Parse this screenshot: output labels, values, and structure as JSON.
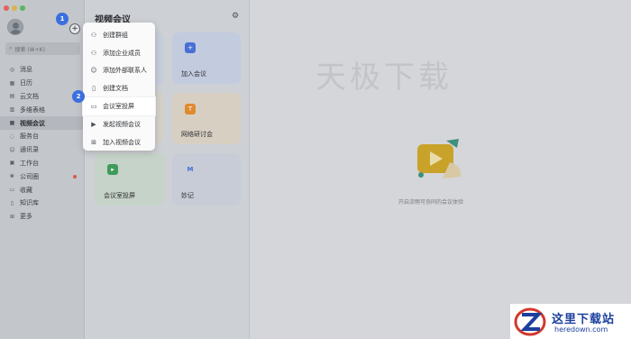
{
  "sidebar": {
    "search_placeholder": "搜索 (⌘+K)",
    "items": [
      {
        "label": "消息",
        "icon": "chat-bubble-icon"
      },
      {
        "label": "日历",
        "icon": "calendar-icon"
      },
      {
        "label": "云文档",
        "icon": "cloud-doc-icon"
      },
      {
        "label": "多维表格",
        "icon": "table-icon"
      },
      {
        "label": "视频会议",
        "icon": "video-icon",
        "active": true
      },
      {
        "label": "服务台",
        "icon": "headset-icon"
      },
      {
        "label": "通讯录",
        "icon": "contacts-icon"
      },
      {
        "label": "工作台",
        "icon": "workbench-icon"
      },
      {
        "label": "公司圈",
        "icon": "moments-icon",
        "dot": true
      },
      {
        "label": "收藏",
        "icon": "bookmark-icon"
      },
      {
        "label": "知识库",
        "icon": "book-icon"
      },
      {
        "label": "更多",
        "icon": "grid-icon"
      }
    ]
  },
  "middle": {
    "title": "视频会议",
    "cards": [
      {
        "label": "加入会议",
        "icon": "plus-icon",
        "color": "#4a6fd4"
      },
      {
        "label": "网络研讨会",
        "icon": "webinar-icon",
        "color": "#e08a2e"
      },
      {
        "label": "会议室投屏",
        "icon": "screen-share-icon",
        "color": "#3f9b5a"
      },
      {
        "label": "妙记",
        "icon": "minutes-icon",
        "color": "#4a6fd4"
      }
    ]
  },
  "menu": {
    "items": [
      {
        "label": "创建群组",
        "icon": "group-icon"
      },
      {
        "label": "添加企业成员",
        "icon": "add-member-icon"
      },
      {
        "label": "添加外部联系人",
        "icon": "add-contact-icon"
      },
      {
        "label": "创建文档",
        "icon": "document-icon"
      },
      {
        "label": "会议室投屏",
        "icon": "screen-share-icon",
        "highlight": true
      },
      {
        "label": "发起视频会议",
        "icon": "video-icon"
      },
      {
        "label": "加入视频会议",
        "icon": "join-icon"
      }
    ]
  },
  "right": {
    "watermark": "天极下载",
    "hint": "开启流畅可协同的会议体验"
  },
  "badges": {
    "one": "1",
    "two": "2"
  },
  "logo": {
    "line1": "这里下载站",
    "line2": "heredown.com"
  },
  "colors": {
    "accent": "#3b6fe0",
    "dot": "#d75a4a"
  }
}
